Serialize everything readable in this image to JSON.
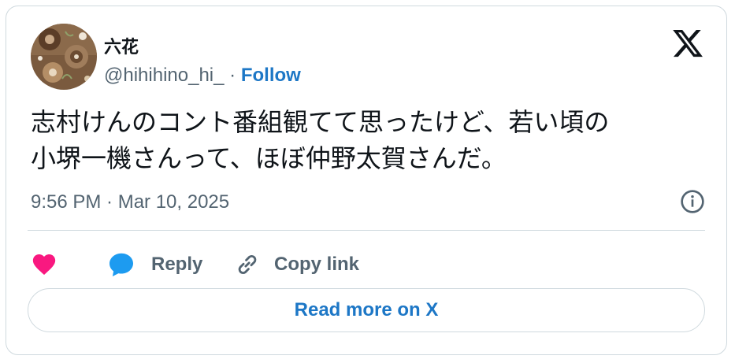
{
  "user": {
    "display_name": "六花",
    "handle": "@hihihino_hi_",
    "separator": "·",
    "follow_label": "Follow",
    "avatar_icon": "avatar-image"
  },
  "header": {
    "logo_icon": "x-logo-icon"
  },
  "tweet": {
    "lines": [
      "志村けんのコント番組観てて思ったけど、若い頃の",
      "小堺一機さんって、ほぼ仲野太賀さんだ。"
    ],
    "timestamp": "9:56 PM · Mar 10, 2025",
    "info_icon": "info-icon"
  },
  "actions": {
    "like_icon": "heart-icon",
    "reply_label": "Reply",
    "reply_icon": "speech-bubble-icon",
    "copy_label": "Copy link",
    "copy_icon": "link-icon"
  },
  "read_more_label": "Read more on X",
  "colors": {
    "accent": "#1d77c6",
    "like": "#f91880",
    "reply": "#1d9bf0",
    "muted": "#536471",
    "border": "#cfd9de"
  }
}
